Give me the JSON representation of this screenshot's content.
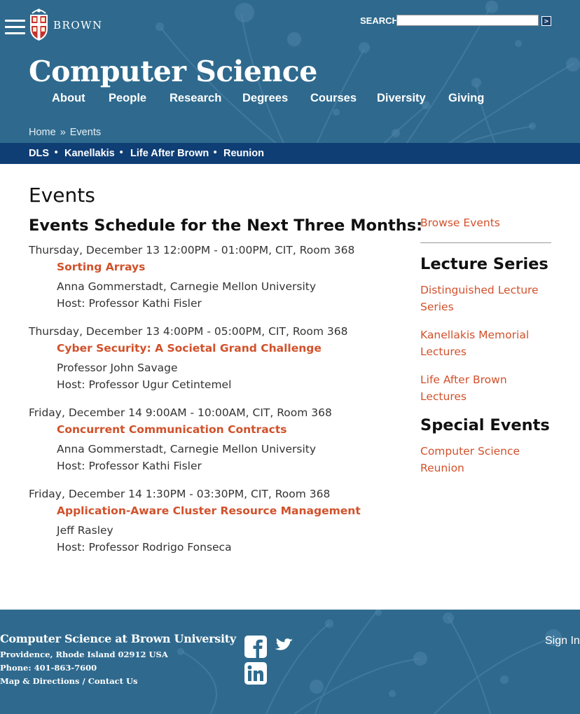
{
  "header": {
    "brand_word": "BROWN",
    "search_label": "SEARCH",
    "search_value": "",
    "search_go": ">",
    "site_title": "Computer Science",
    "nav": [
      "About",
      "People",
      "Research",
      "Degrees",
      "Courses",
      "Diversity",
      "Giving"
    ],
    "breadcrumb": {
      "home": "Home",
      "sep": "»",
      "current": "Events"
    },
    "subnav": [
      "DLS",
      "Kanellakis",
      "Life After Brown",
      "Reunion"
    ],
    "subnav_sep": "•"
  },
  "main": {
    "page_title": "Events",
    "schedule_title": "Events Schedule for the Next Three Months:",
    "events": [
      {
        "when": "Thursday, December 13 12:00PM - 01:00PM, CIT, Room 368",
        "title": "Sorting Arrays",
        "speaker": "Anna Gommerstadt, Carnegie Mellon University",
        "host": "Host: Professor Kathi Fisler"
      },
      {
        "when": "Thursday, December 13 4:00PM - 05:00PM, CIT, Room 368",
        "title": "Cyber Security: A Societal Grand Challenge",
        "speaker": "Professor John Savage",
        "host": "Host: Professor Ugur Cetintemel"
      },
      {
        "when": "Friday, December 14 9:00AM - 10:00AM, CIT, Room 368",
        "title": "Concurrent Communication Contracts",
        "speaker": "Anna Gommerstadt, Carnegie Mellon University",
        "host": "Host: Professor Kathi Fisler"
      },
      {
        "when": "Friday, December 14 1:30PM - 03:30PM, CIT, Room 368",
        "title": "Application-Aware Cluster Resource Management",
        "speaker": "Jeff Rasley",
        "host": "Host: Professor Rodrigo Fonseca"
      }
    ]
  },
  "sidebar": {
    "browse": "Browse Events",
    "lecture_heading": "Lecture Series",
    "lecture_links": [
      [
        "Distinguished Lecture",
        "Series"
      ],
      [
        "Kanellakis Memorial",
        "Lectures"
      ],
      [
        "Life After Brown",
        "Lectures"
      ]
    ],
    "special_heading": "Special Events",
    "special_links": [
      [
        "Computer Science",
        "Reunion"
      ]
    ]
  },
  "footer": {
    "name": "Computer Science at Brown University",
    "address": "Providence, Rhode Island 02912 USA",
    "phone": "Phone: 401-863-7600",
    "links": "Map & Directions / Contact Us",
    "sign_in": "Sign In",
    "social_icons": [
      "facebook-icon",
      "twitter-icon",
      "linkedin-icon"
    ]
  },
  "colors": {
    "header_bg": "#2f6a8e",
    "subnav_bg": "#0f3e75",
    "link": "#d1512b"
  }
}
